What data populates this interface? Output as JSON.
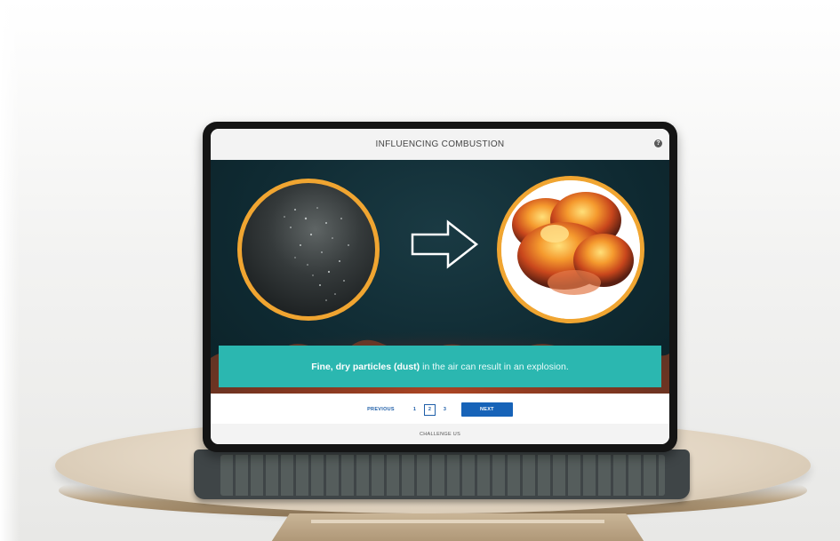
{
  "app": {
    "title": "INFLUENCING COMBUSTION",
    "help_icon": "question-mark-icon"
  },
  "slide": {
    "left_image": "dust-particles-image",
    "arrow_icon": "right-arrow-outline-icon",
    "right_image": "explosion-image",
    "caption_bold": "Fine, dry particles (dust)",
    "caption_rest": "in the air can result in an explosion."
  },
  "pager": {
    "previous_label": "PREVIOUS",
    "pages": [
      "1",
      "2",
      "3"
    ],
    "current_page": "2",
    "next_label": "NEXT"
  },
  "footer": {
    "challenge_label": "CHALLENGE US"
  },
  "colors": {
    "accent_teal": "#2bb7b0",
    "ring_orange": "#f0a531",
    "button_blue": "#1763b8",
    "stage_dark": "#0f2a32"
  }
}
